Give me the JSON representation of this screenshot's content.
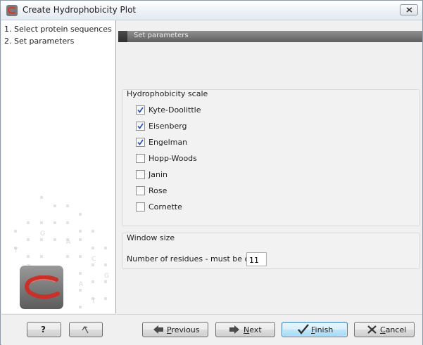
{
  "window": {
    "title": "Create Hydrophobicity Plot",
    "icon": "clc-logo-icon",
    "close_icon": "close-x-icon"
  },
  "steps": [
    {
      "label": "1. Select protein sequences"
    },
    {
      "label": "2. Set parameters"
    }
  ],
  "section": {
    "title": "Set parameters"
  },
  "hydrophobicity": {
    "title": "Hydrophobicity scale",
    "options": [
      {
        "label": "Kyte-Doolittle",
        "checked": true
      },
      {
        "label": "Eisenberg",
        "checked": true
      },
      {
        "label": "Engelman",
        "checked": true
      },
      {
        "label": "Hopp-Woods",
        "checked": false
      },
      {
        "label": "Janin",
        "checked": false
      },
      {
        "label": "Rose",
        "checked": false
      },
      {
        "label": "Cornette",
        "checked": false
      }
    ]
  },
  "window_size": {
    "title": "Window size",
    "label": "Number of residues - must be odd:",
    "value": "11"
  },
  "buttons": {
    "help": {
      "label": "?"
    },
    "reset": {
      "icon": "reset-arrow-icon"
    },
    "previous": {
      "first": "P",
      "rest": "revious",
      "icon": "left-arrow-icon"
    },
    "next": {
      "first": "N",
      "rest": "ext",
      "icon": "right-arrow-icon"
    },
    "finish": {
      "first": "F",
      "rest": "inish",
      "icon": "checkmark-icon"
    },
    "cancel": {
      "first": "C",
      "rest": "ancel",
      "icon": "cancel-x-icon"
    }
  },
  "colors": {
    "accent": "#3c7fb1",
    "header_bar": "#6f6f6f",
    "logo_red": "#c8302a",
    "check_blue": "#2b4fa8"
  }
}
